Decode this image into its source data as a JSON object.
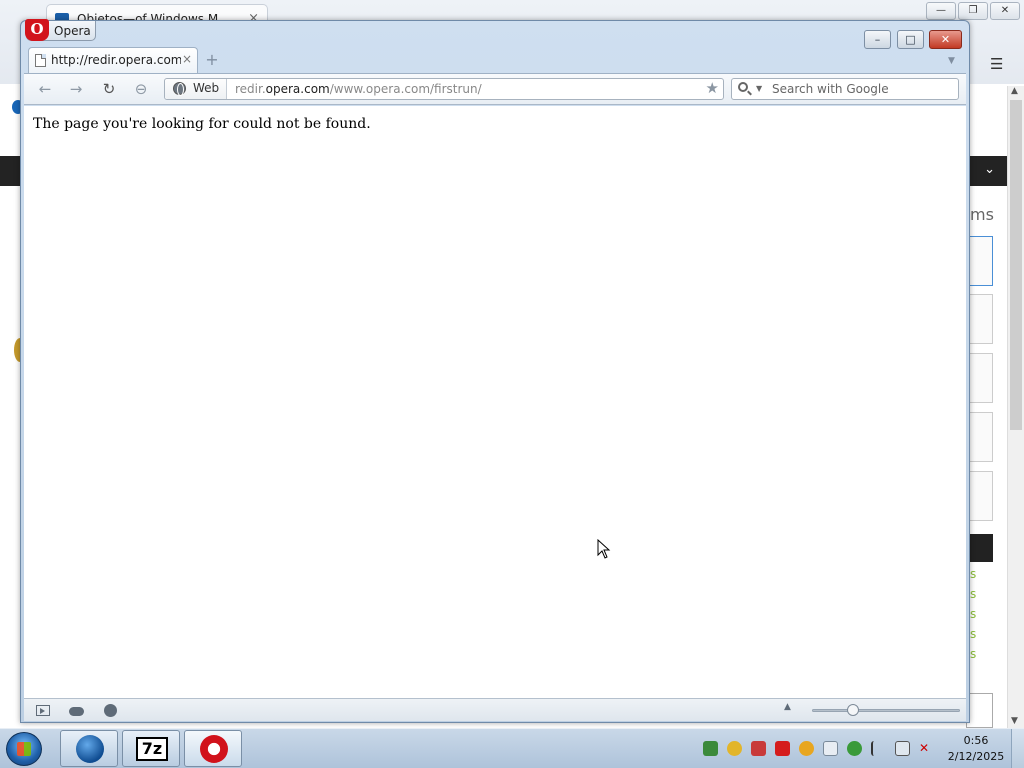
{
  "background_window": {
    "tab_title": "Objetos—of Windows M...",
    "menu_icon": "hamburger-icon",
    "heading_fragment": "ms",
    "link_fragment": "s",
    "controls": {
      "min": "—",
      "max": "❐",
      "close": "✕"
    }
  },
  "opera": {
    "menu_button_label": "Opera",
    "window_controls": {
      "min": "–",
      "max": "□",
      "close": "✕"
    },
    "tab": {
      "title": "http://redir.opera.com...",
      "close": "×"
    },
    "new_tab": "+",
    "toolbar": {
      "back": "←",
      "forward": "→",
      "reload": "↻",
      "key": "⊖"
    },
    "address": {
      "type_label": "Web",
      "url_prefix": "redir.",
      "url_domain": "opera.com",
      "url_path": "/www.opera.com/firstrun/",
      "star": "★"
    },
    "search": {
      "placeholder": "Search with Google"
    },
    "content": {
      "message": "The page you're looking for could not be found."
    },
    "statusbar": {
      "up_arrow": "▲"
    }
  },
  "taskbar": {
    "apps": [
      {
        "name": "Internet Explorer",
        "icon": "ie-icon"
      },
      {
        "name": "7-Zip",
        "icon": "7zip-icon",
        "label": "7z"
      },
      {
        "name": "Opera",
        "icon": "opera-icon"
      }
    ],
    "clock": {
      "time": "0:56",
      "date": "2/12/2025"
    }
  }
}
